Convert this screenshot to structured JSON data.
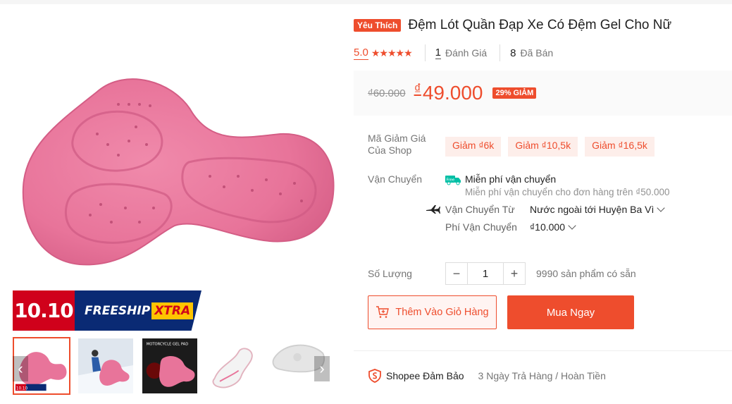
{
  "product": {
    "badge": "Yêu Thích",
    "title": "Đệm Lót Quần Đạp Xe Có Đệm Gel Cho Nữ"
  },
  "rating": {
    "score": "5.0",
    "stars": "★★★★★",
    "review_count": "1",
    "review_label": "Đánh Giá",
    "sold_count": "8",
    "sold_label": "Đã Bán"
  },
  "price": {
    "original": "₫60.000",
    "currency": "₫",
    "current": "49.000",
    "discount": "29% GIẢM"
  },
  "vouchers": {
    "label": "Mã Giảm Giá Của Shop",
    "items": [
      "Giảm ₫6k",
      "Giảm ₫10,5k",
      "Giảm ₫16,5k"
    ]
  },
  "shipping": {
    "label": "Vận Chuyển",
    "free_icon_text": "Free",
    "free_title": "Miễn phí vận chuyển",
    "free_sub": "Miễn phí vận chuyển cho đơn hàng trên ₫50.000",
    "from_label": "Vận Chuyển Từ",
    "from_value": "Nước ngoài tới Huyện Ba Vì",
    "fee_label": "Phí Vận Chuyển",
    "fee_value": "₫10.000"
  },
  "quantity": {
    "label": "Số Lượng",
    "minus": "−",
    "value": "1",
    "plus": "+",
    "stock": "9990 sản phẩm có sẵn"
  },
  "actions": {
    "add_to_cart": "Thêm Vào Giỏ Hàng",
    "buy_now": "Mua Ngay"
  },
  "guarantee": {
    "name": "Shopee Đảm Bảo",
    "text": "3 Ngày Trả Hàng / Hoàn Tiền"
  },
  "promo": {
    "date": "10.10",
    "freeship": "FREESHIP",
    "xtra": "XTRA"
  },
  "thumbs": {
    "moto_caption": "MOTORCYCLE GEL PAD",
    "mini_date": "10.10",
    "mini_text": "FREESHIP XTRA"
  },
  "gallery": {
    "prev": "‹",
    "next": "›"
  },
  "colors": {
    "accent": "#ee4d2d",
    "pad_pink": "#e9799a",
    "banner_red": "#d0011b",
    "banner_navy": "#0a2a74",
    "banner_yellow": "#ffc400"
  }
}
